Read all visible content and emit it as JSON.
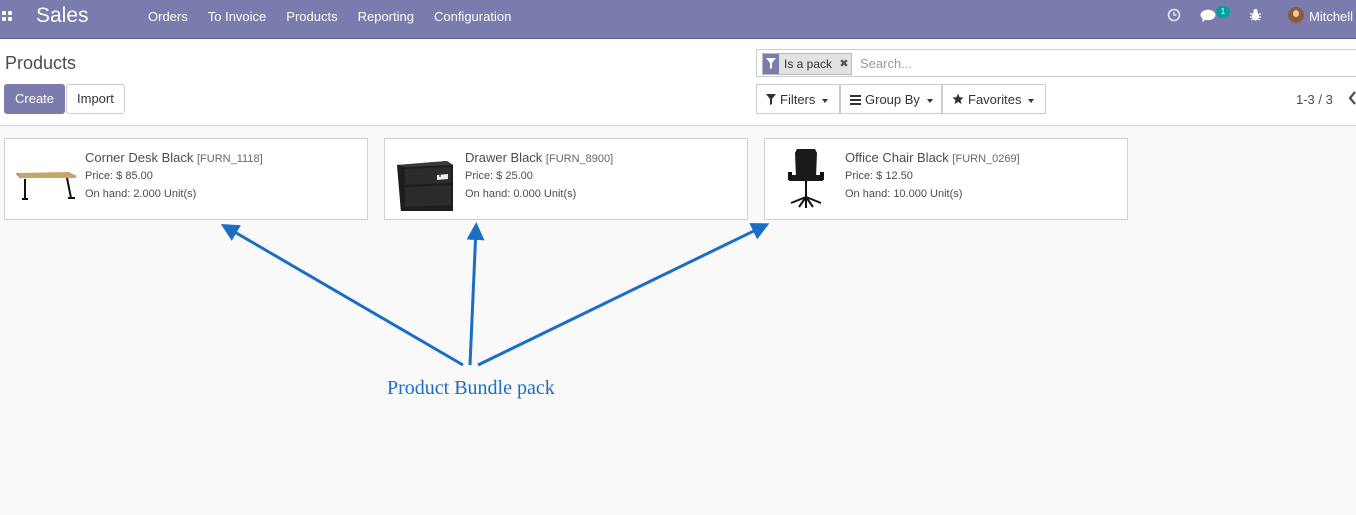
{
  "navbar": {
    "app_name": "Sales",
    "menu": [
      "Orders",
      "To Invoice",
      "Products",
      "Reporting",
      "Configuration"
    ],
    "icons": [
      "apps-icon",
      "clock-icon",
      "chat-icon",
      "bug-icon"
    ],
    "messages_badge": "1",
    "user_name": "Mitchell",
    "accent_color": "#7c7bad"
  },
  "control_panel": {
    "breadcrumb": "Products",
    "create_label": "Create",
    "import_label": "Import",
    "search": {
      "facet_label": "Is a pack",
      "facet_remove": "✖",
      "placeholder": "Search..."
    },
    "filters_label": "Filters",
    "group_by_label": "Group By",
    "favorites_label": "Favorites",
    "pager": "1-3 / 3"
  },
  "products": [
    {
      "name": "Corner Desk Black",
      "ref": "[FURN_1118]",
      "price": "Price: $ 85.00",
      "on_hand": "On hand: 2.000 Unit(s)",
      "image": "desk-image"
    },
    {
      "name": "Drawer Black",
      "ref": "[FURN_8900]",
      "price": "Price: $ 25.00",
      "on_hand": "On hand: 0.000 Unit(s)",
      "image": "drawer-image"
    },
    {
      "name": "Office Chair Black",
      "ref": "[FURN_0269]",
      "price": "Price: $ 12.50",
      "on_hand": "On hand: 10.000 Unit(s)",
      "image": "chair-image"
    }
  ],
  "annotation": {
    "text": "Product Bundle pack",
    "color": "#1a6fc4"
  }
}
